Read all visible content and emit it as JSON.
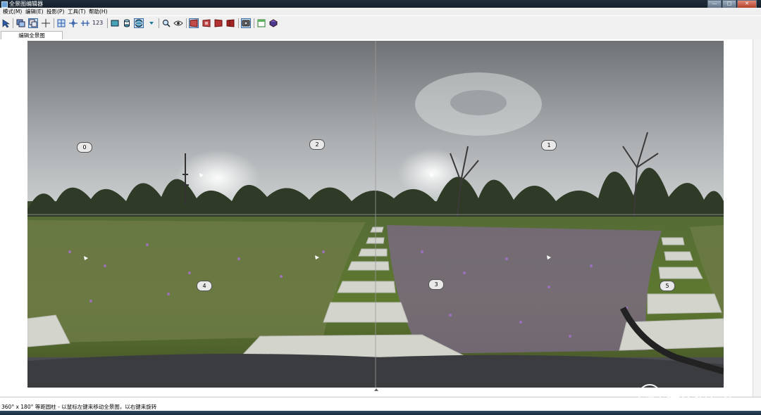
{
  "window": {
    "title": "全景图编辑器",
    "min_label": "—",
    "max_label": "□",
    "close_label": "✕"
  },
  "menu": [
    {
      "label": "模式(M)"
    },
    {
      "label": "编辑(E)"
    },
    {
      "label": "投影(P)"
    },
    {
      "label": "工具(T)"
    },
    {
      "label": "帮助(H)"
    }
  ],
  "toolbar": {
    "count_label": "123",
    "icons": [
      "select-arrow-icon",
      "images-icon",
      "layers-icon",
      "crosshair-icon",
      "grid-icon",
      "move-crosshair-icon",
      "align-icon",
      "count-icon",
      "rectilinear-icon",
      "cylinder-icon",
      "sphere-icon",
      "dropdown-arrow-icon",
      "magnifier-icon",
      "eye-icon",
      "frame-red-1-icon",
      "frame-red-2-icon",
      "frame-red-3-icon",
      "frame-red-4-icon",
      "camera-icon",
      "window-icon",
      "book-icon"
    ]
  },
  "tab": {
    "label": "编辑全景图"
  },
  "panorama": {
    "markers": [
      {
        "id": "0",
        "label": "0"
      },
      {
        "id": "2",
        "label": "2"
      },
      {
        "id": "1",
        "label": "1"
      },
      {
        "id": "4",
        "label": "4"
      },
      {
        "id": "3",
        "label": "3"
      },
      {
        "id": "5",
        "label": "5"
      }
    ]
  },
  "status": {
    "text": "360° x 180° 等距圆柱 - 以鼠标左键来移动全景图，以右键来旋转"
  },
  "watermark": {
    "text": "什么值得买",
    "logo_char": "值"
  },
  "colors": {
    "sky_top": "#76797c",
    "sky_bottom": "#bfc3c4",
    "grass": "#5f7a35",
    "flowers": "#9a5fbf",
    "path_stone": "#cfd0c8"
  }
}
